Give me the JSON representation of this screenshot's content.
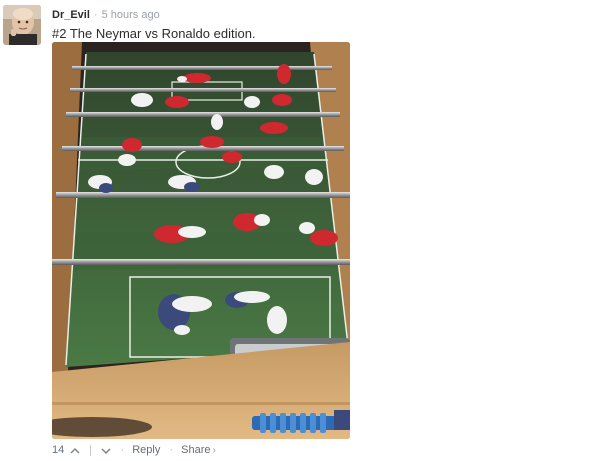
{
  "comment": {
    "author": "Dr_Evil",
    "separator": "·",
    "timestamp": "5 hours ago",
    "text": "#2 The Neymar vs Ronaldo edition.",
    "image_icon": "foosball-photo"
  },
  "footer": {
    "upvotes": "14",
    "upvote_icon": "chevron-up-icon",
    "downvote_icon": "chevron-down-icon",
    "dot": "·",
    "reply_label": "Reply",
    "share_label": "Share",
    "share_chevron": "›"
  },
  "colors": {
    "author": "#2a2e2e",
    "timestamp": "#9aa3a8",
    "footer_text": "#656c7a",
    "field_green": "#3e6b3c",
    "red_team": "#d0282f",
    "blue_team": "#3b4a7a"
  }
}
